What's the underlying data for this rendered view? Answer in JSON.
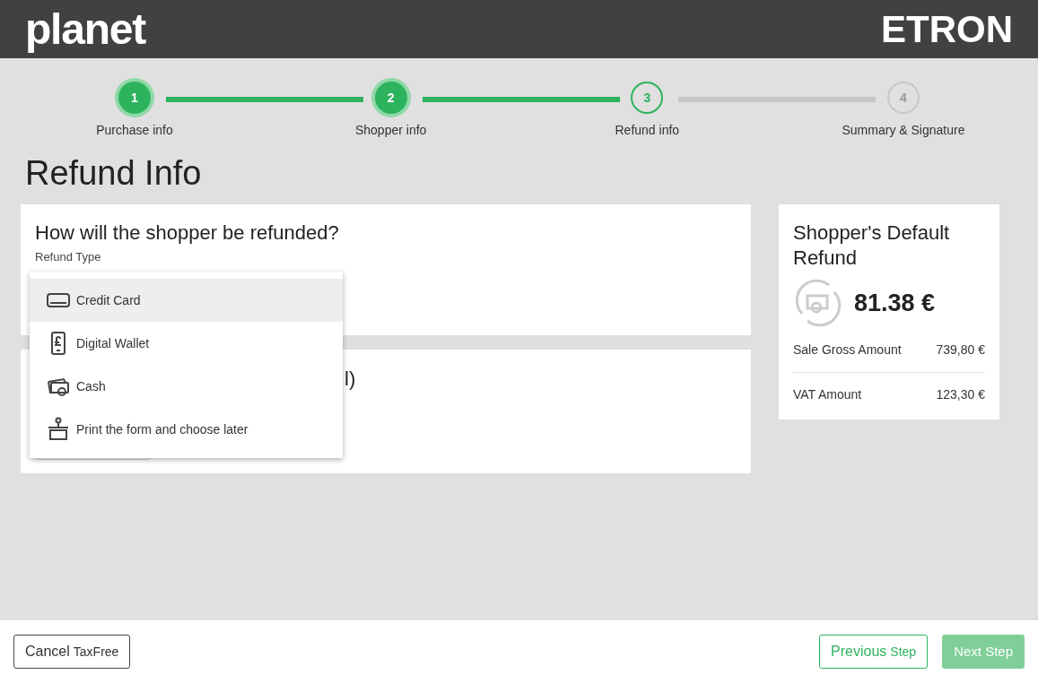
{
  "header": {
    "logo_left": "planet",
    "logo_right": "ETRON"
  },
  "steps": [
    {
      "number": "1",
      "label": "Purchase info",
      "completed": true,
      "selected": false
    },
    {
      "number": "2",
      "label": "Shopper info",
      "completed": true,
      "selected": false
    },
    {
      "number": "3",
      "label": "Refund info",
      "completed": false,
      "selected": true
    },
    {
      "number": "4",
      "label": "Summary & Signature",
      "completed": false,
      "selected": false
    }
  ],
  "page_title": "Refund Info",
  "refund_card": {
    "title": "How will the shopper be refunded?",
    "field_label": "Refund Type"
  },
  "second_card": {
    "title_visible": "l)"
  },
  "dropdown": [
    {
      "label": "Credit Card",
      "kind": "card",
      "selected": true
    },
    {
      "label": "Digital Wallet",
      "kind": "wallet",
      "selected": false
    },
    {
      "label": "Cash",
      "kind": "cash",
      "selected": false
    },
    {
      "label": "Print the form and choose later",
      "kind": "print",
      "selected": false
    }
  ],
  "summary": {
    "title": "Shopper's Default Refund",
    "amount": "81.38 €",
    "rows": [
      {
        "label": "Sale Gross Amount",
        "value": "739,80 €"
      },
      {
        "label": "VAT Amount",
        "value": "123,30 €"
      }
    ]
  },
  "footer": {
    "cancel": {
      "main": "Cancel",
      "suffix": "TaxFree"
    },
    "previous": {
      "main": "Previous",
      "suffix": "Step"
    },
    "next": {
      "label": "Next Step",
      "disabled": true
    }
  }
}
